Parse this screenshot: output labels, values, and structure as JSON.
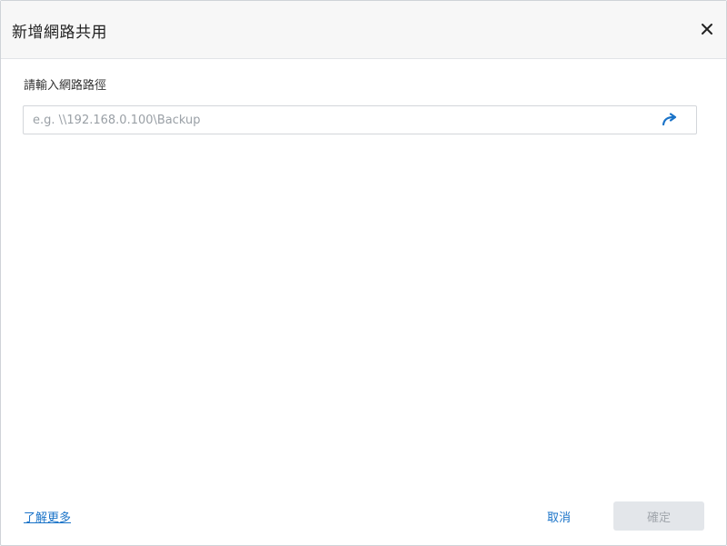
{
  "dialog": {
    "title": "新增網路共用",
    "close_icon": "close-icon"
  },
  "form": {
    "label": "請輸入網路路徑",
    "path_input": {
      "value": "",
      "placeholder": "e.g. \\\\192.168.0.100\\Backup"
    },
    "go_icon": "arrow-redo-icon"
  },
  "footer": {
    "learn_more": "了解更多",
    "cancel_label": "取消",
    "ok_label": "確定",
    "ok_disabled": true
  },
  "colors": {
    "accent": "#1a73c8",
    "header_bg": "#f7f7f7",
    "disabled_button_bg": "#e3e6ea",
    "disabled_button_text": "#a2a7ad"
  }
}
